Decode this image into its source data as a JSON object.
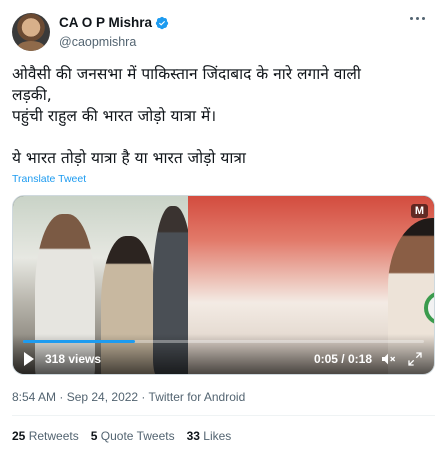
{
  "author": {
    "display_name": "CA O P Mishra",
    "handle": "@caopmishra"
  },
  "tweet": {
    "lines": [
      "ओवैसी की जनसभा में पाकिस्तान जिंदाबाद के नारे लगाने वाली",
      "लड़की,",
      "पहुंची राहुल की भारत जोड़ो यात्रा में।",
      "",
      "ये भारत तोड़ो यात्रा है या भारत जोड़ो यात्रा"
    ],
    "translate_label": "Translate Tweet"
  },
  "video": {
    "views": "318 views",
    "time": "0:05 / 0:18",
    "watermark": "M",
    "progress": 0.28
  },
  "meta": {
    "timestamp": "8:54 AM · Sep 24, 2022 · Twitter for Android"
  },
  "stats": {
    "retweets_count": "25",
    "retweets_label": "Retweets",
    "quotes_count": "5",
    "quotes_label": "Quote Tweets",
    "likes_count": "33",
    "likes_label": "Likes"
  },
  "colors": {
    "accent": "#1d9bf0",
    "text": "#0f1419",
    "secondary": "#536471"
  }
}
